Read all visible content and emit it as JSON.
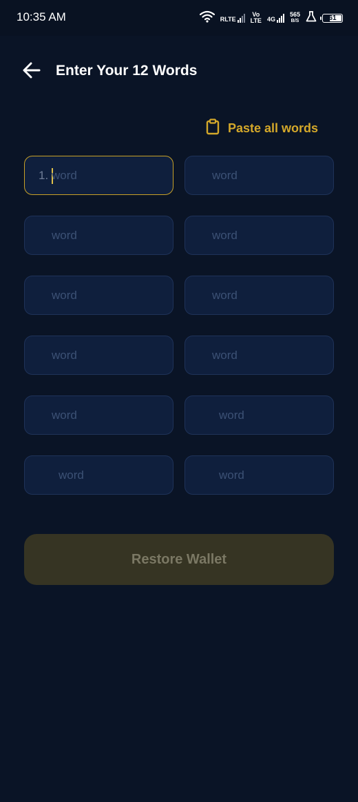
{
  "status_bar": {
    "time": "10:35 AM",
    "sim1_label": "RLTE",
    "volte_top": "Vo",
    "volte_bottom": "LTE",
    "sim2_label": "4G",
    "net_speed_value": "565",
    "net_speed_unit": "B/S",
    "battery_level": "61",
    "icons": [
      "wifi-icon",
      "signal-icon",
      "signal-icon",
      "lab-flask-icon",
      "battery-icon"
    ]
  },
  "header": {
    "title": "Enter Your 12 Words",
    "back_icon": "arrow-left-icon"
  },
  "paste": {
    "label": "Paste all words",
    "icon": "clipboard-icon",
    "color": "#d4a82a"
  },
  "words": {
    "first_prefix": "1.",
    "fields": [
      {
        "placeholder": "word"
      },
      {
        "placeholder": "word"
      },
      {
        "placeholder": "word"
      },
      {
        "placeholder": "word"
      },
      {
        "placeholder": "word"
      },
      {
        "placeholder": "word"
      },
      {
        "placeholder": "word"
      },
      {
        "placeholder": "word"
      },
      {
        "placeholder": "word"
      },
      {
        "placeholder": "word"
      },
      {
        "placeholder": "word"
      },
      {
        "placeholder": "word"
      }
    ]
  },
  "restore": {
    "label": "Restore Wallet"
  },
  "colors": {
    "background": "#0a1426",
    "field_background": "#0f1f3d",
    "field_border": "#1f3359",
    "focus_border": "#c9a227",
    "accent": "#d4a82a",
    "button_disabled": "#363423"
  }
}
